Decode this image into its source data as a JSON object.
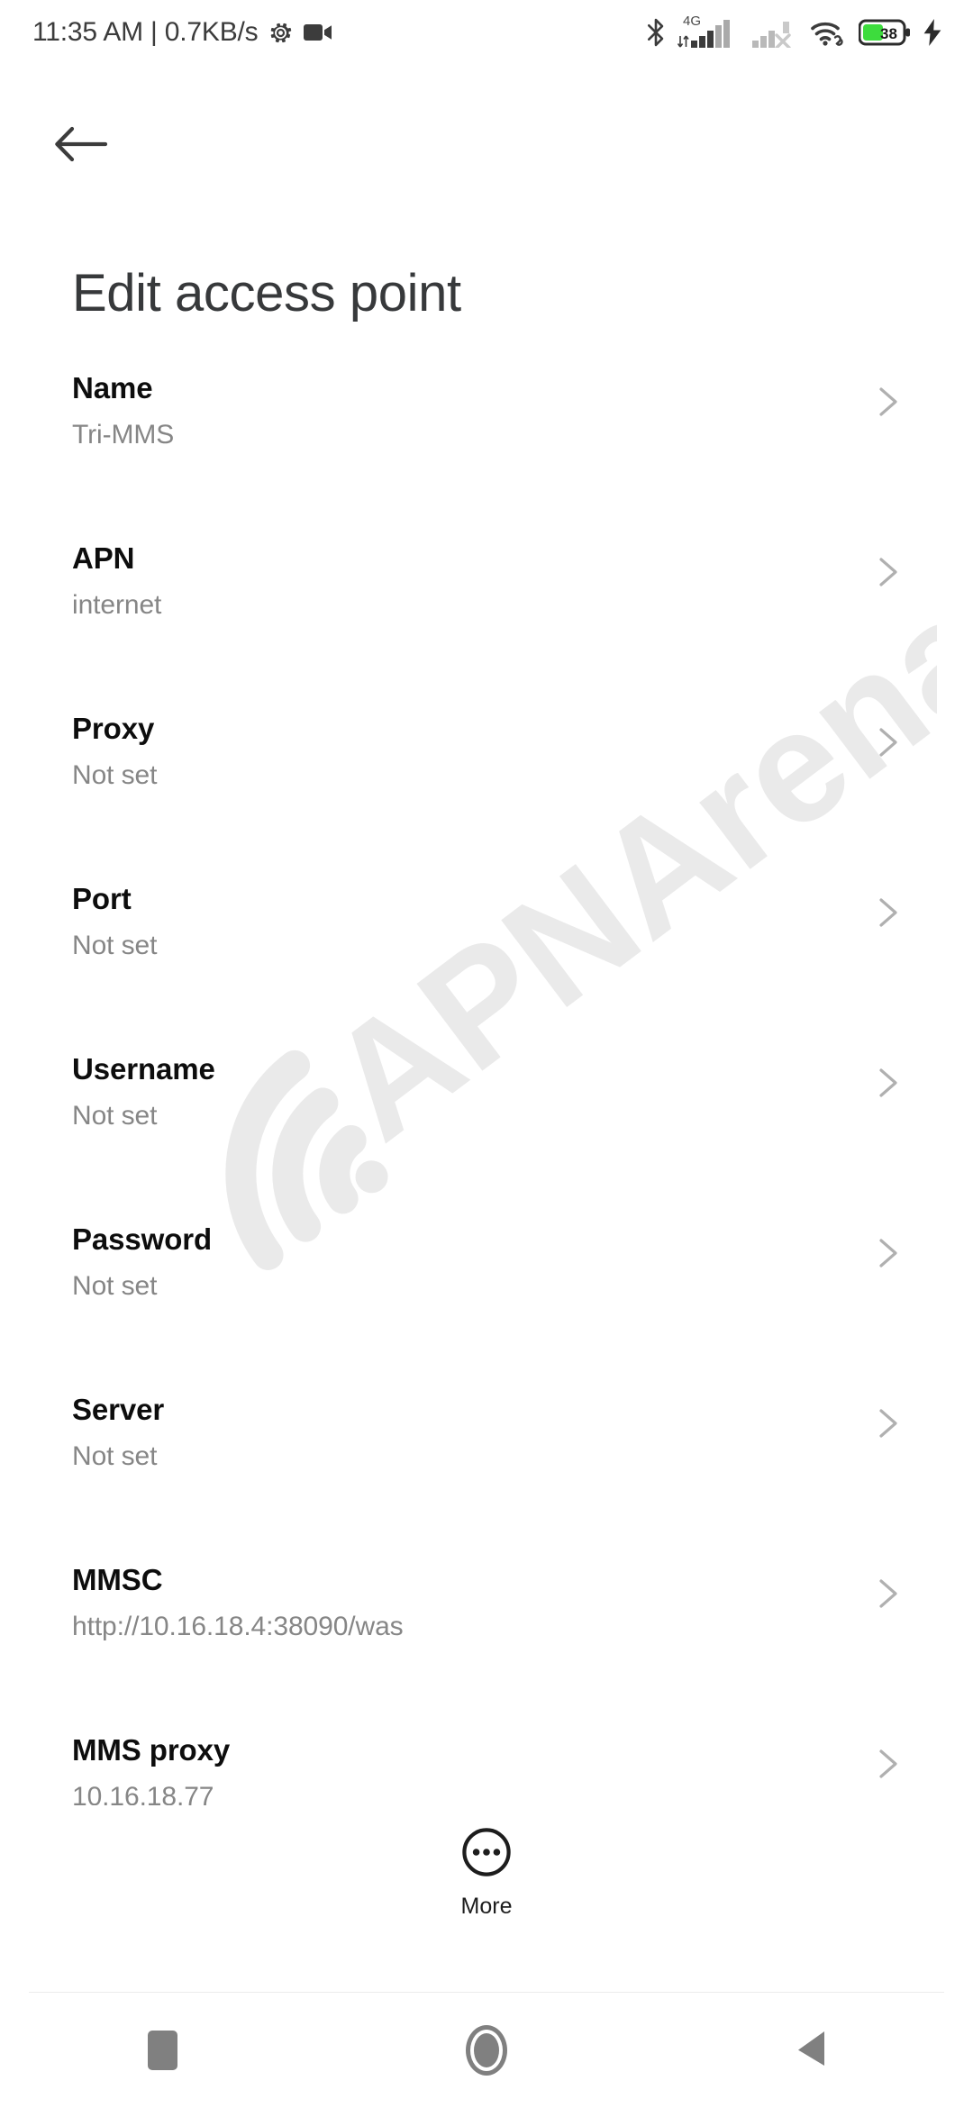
{
  "status_bar": {
    "clock_text": "11:35 AM | 0.7KB/s",
    "icons": {
      "settings": "gear-icon",
      "screen_recorder": "video-camera-icon",
      "bluetooth": "bluetooth-icon",
      "sim1": "signal-4g-icon",
      "sim2": "signal-no-service-icon",
      "wifi": "wifi-link-icon",
      "battery": "battery-icon",
      "charging": "charging-bolt-icon"
    },
    "network_label": "4G",
    "battery_level": "38",
    "battery_fill_color": "#3ddc3d"
  },
  "header": {
    "back_icon": "arrow-left-icon",
    "title": "Edit access point"
  },
  "watermark": {
    "text": "APNArena",
    "color": "#eaeaea"
  },
  "settings": {
    "rows": [
      {
        "title": "Name",
        "value": "Tri-MMS"
      },
      {
        "title": "APN",
        "value": "internet"
      },
      {
        "title": "Proxy",
        "value": "Not set"
      },
      {
        "title": "Port",
        "value": "Not set"
      },
      {
        "title": "Username",
        "value": "Not set"
      },
      {
        "title": "Password",
        "value": "Not set"
      },
      {
        "title": "Server",
        "value": "Not set"
      },
      {
        "title": "MMSC",
        "value": "http://10.16.18.4:38090/was"
      },
      {
        "title": "MMS proxy",
        "value": "10.16.18.77"
      }
    ]
  },
  "more_button": {
    "label": "More",
    "icon": "more-dots-circle-icon"
  },
  "nav_bar": {
    "recents_label": "recents-icon",
    "home_label": "home-icon",
    "back_label": "back-triangle-icon",
    "color": "#808080"
  }
}
